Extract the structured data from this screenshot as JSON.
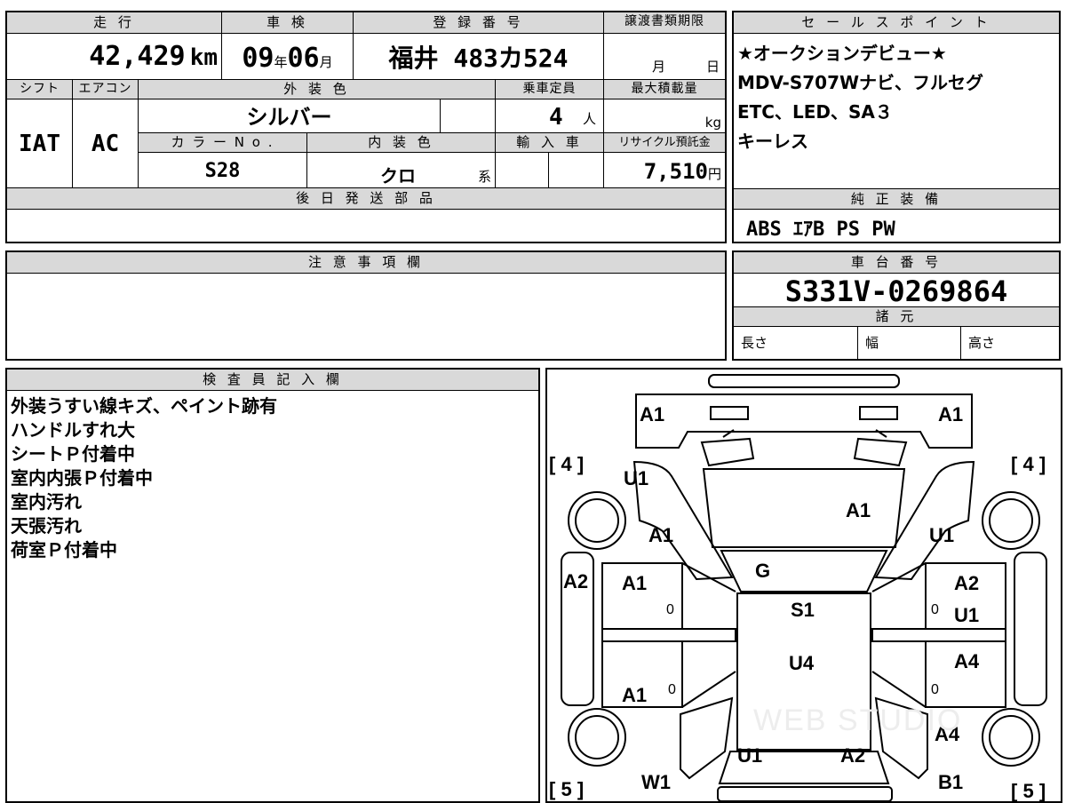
{
  "vehicle": {
    "mileage_label": "走 行",
    "mileage_value": "42,429",
    "mileage_unit": "km",
    "inspection_label": "車 検",
    "inspection_year": "09",
    "inspection_year_unit": "年",
    "inspection_month": "06",
    "inspection_month_unit": "月",
    "reg_label": "登 録 番 号",
    "reg_value": "福井 483カ524",
    "transfer_label": "譲渡書類期限",
    "transfer_month": "月",
    "transfer_day": "日",
    "shift_label": "シフト",
    "shift_value": "IAT",
    "ac_label": "エアコン",
    "ac_value": "AC",
    "exterior_label": "外 装 色",
    "exterior_value": "シルバー",
    "capacity_label": "乗車定員",
    "capacity_value": "4",
    "capacity_unit": "人",
    "maxload_label": "最大積載量",
    "maxload_unit": "kg",
    "colorno_label": "カ ラ ー N o .",
    "colorno_value": "S28",
    "interior_label": "内 装 色",
    "interior_value": "クロ",
    "interior_unit": "系",
    "import_label": "輸 入 車",
    "recycle_label": "リサイクル預託金",
    "recycle_value": "7,510",
    "recycle_unit": "円",
    "parts_label": "後 日 発 送 部 品"
  },
  "sales_point": {
    "label": "セ ー ル ス ポ イ ン ト",
    "lines": [
      "★オークションデビュー★",
      "MDV-S707Wナビ、フルセグ",
      "ETC、LED、SA３",
      "キーレス"
    ]
  },
  "equipment": {
    "label": "純 正 装 備",
    "value": "ABS ｴｱB PS PW"
  },
  "notes": {
    "label": "注 意 事 項 欄"
  },
  "chassis": {
    "label": "車 台 番 号",
    "value": "S331V-0269864",
    "spec_label": "諸 元",
    "length_label": "長さ",
    "width_label": "幅",
    "height_label": "高さ"
  },
  "inspector": {
    "label": "検 査 員 記 入 欄",
    "lines": [
      "外装うすい線キズ、ペイント跡有",
      "ハンドルすれ大",
      "シートＰ付着中",
      "室内内張Ｐ付着中",
      "室内汚れ",
      "天張汚れ",
      "荷室Ｐ付着中"
    ]
  },
  "diagram": {
    "tire_tl": "4",
    "tire_tr": "4",
    "tire_bl": "5",
    "tire_br": "5",
    "marks": {
      "front_bumper_left": "A1",
      "front_bumper_right": "A1",
      "fender_fl": "U1",
      "hood": "A1",
      "front_l": "A1",
      "fender_fr": "U1",
      "windshield": "G",
      "pillar_l": "A2",
      "door_fl": "A1",
      "roof": "S1",
      "pillar_r": "A2",
      "door_fr": "U1",
      "roof_rear": "U4",
      "door_rr": "A4",
      "door_rl": "A1",
      "quarter_rr": "A4",
      "rear_l": "W1",
      "rear_c": "U1",
      "rear_c2": "A2",
      "rear_r": "B1",
      "zero_1": "0",
      "zero_2": "0",
      "zero_3": "0",
      "zero_4": "0"
    }
  },
  "watermark": "WEB STUDIO"
}
